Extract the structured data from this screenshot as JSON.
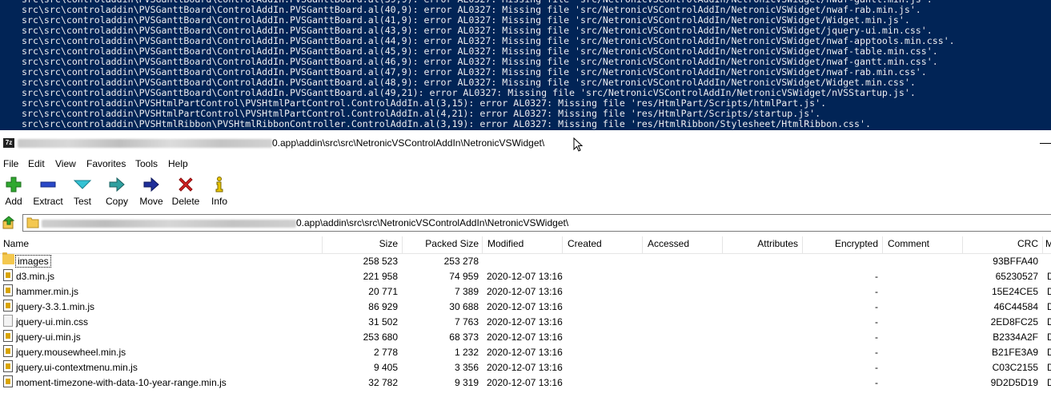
{
  "console": {
    "lines": [
      "src\\src\\controladdin\\PVSGanttBoard\\ControlAddIn.PVSGanttBoard.al(39,9): error AL0327: Missing file 'src/NetronicVSControlAddIn/NetronicVSWidget/nwaf-gantt.min.js'.",
      "src\\src\\controladdin\\PVSGanttBoard\\ControlAddIn.PVSGanttBoard.al(40,9): error AL0327: Missing file 'src/NetronicVSControlAddIn/NetronicVSWidget/nwaf-rab.min.js'.",
      "src\\src\\controladdin\\PVSGanttBoard\\ControlAddIn.PVSGanttBoard.al(41,9): error AL0327: Missing file 'src/NetronicVSControlAddIn/NetronicVSWidget/Widget.min.js'.",
      "src\\src\\controladdin\\PVSGanttBoard\\ControlAddIn.PVSGanttBoard.al(43,9): error AL0327: Missing file 'src/NetronicVSControlAddIn/NetronicVSWidget/jquery-ui.min.css'.",
      "src\\src\\controladdin\\PVSGanttBoard\\ControlAddIn.PVSGanttBoard.al(44,9): error AL0327: Missing file 'src/NetronicVSControlAddIn/NetronicVSWidget/nwaf-apptools.min.css'.",
      "src\\src\\controladdin\\PVSGanttBoard\\ControlAddIn.PVSGanttBoard.al(45,9): error AL0327: Missing file 'src/NetronicVSControlAddIn/NetronicVSWidget/nwaf-table.min.css'.",
      "src\\src\\controladdin\\PVSGanttBoard\\ControlAddIn.PVSGanttBoard.al(46,9): error AL0327: Missing file 'src/NetronicVSControlAddIn/NetronicVSWidget/nwaf-gantt.min.css'.",
      "src\\src\\controladdin\\PVSGanttBoard\\ControlAddIn.PVSGanttBoard.al(47,9): error AL0327: Missing file 'src/NetronicVSControlAddIn/NetronicVSWidget/nwaf-rab.min.css'.",
      "src\\src\\controladdin\\PVSGanttBoard\\ControlAddIn.PVSGanttBoard.al(48,9): error AL0327: Missing file 'src/NetronicVSControlAddIn/NetronicVSWidget/Widget.min.css'.",
      "src\\src\\controladdin\\PVSGanttBoard\\ControlAddIn.PVSGanttBoard.al(49,21): error AL0327: Missing file 'src/NetronicVSControlAddIn/NetronicVSWidget/nVSStartup.js'.",
      "src\\src\\controladdin\\PVSHtmlPartControl\\PVSHtmlPartControl.ControlAddIn.al(3,15): error AL0327: Missing file 'res/HtmlPart/Scripts/htmlPart.js'.",
      "src\\src\\controladdin\\PVSHtmlPartControl\\PVSHtmlPartControl.ControlAddIn.al(4,21): error AL0327: Missing file 'res/HtmlPart/Scripts/startup.js'.",
      "src\\src\\controladdin\\PVSHtmlRibbon\\PVSHtmlRibbonController.ControlAddIn.al(3,19): error AL0327: Missing file 'res/HtmlRibbon/Stylesheet/HtmlRibbon.css'."
    ]
  },
  "window": {
    "app_icon": "7z",
    "title_suffix": "0.app\\addin\\src\\src\\NetronicVSControlAddIn\\NetronicVSWidget\\"
  },
  "menu": [
    "File",
    "Edit",
    "View",
    "Favorites",
    "Tools",
    "Help"
  ],
  "toolbar": {
    "add": "Add",
    "extract": "Extract",
    "test": "Test",
    "copy": "Copy",
    "move": "Move",
    "delete": "Delete",
    "info": "Info"
  },
  "address": {
    "path_suffix": "0.app\\addin\\src\\src\\NetronicVSControlAddIn\\NetronicVSWidget\\"
  },
  "columns": {
    "name": "Name",
    "size": "Size",
    "packed_size": "Packed Size",
    "modified": "Modified",
    "created": "Created",
    "accessed": "Accessed",
    "attributes": "Attributes",
    "encrypted": "Encrypted",
    "comment": "Comment",
    "crc": "CRC",
    "more": "M"
  },
  "files": [
    {
      "name": "images",
      "type": "folder",
      "size": "258 523",
      "packed": "253 278",
      "modified": "",
      "encrypted": "",
      "crc": "93BFFA40",
      "more": ""
    },
    {
      "name": "d3.min.js",
      "type": "js",
      "size": "221 958",
      "packed": "74 959",
      "modified": "2020-12-07 13:16",
      "encrypted": "-",
      "crc": "65230527",
      "more": "D"
    },
    {
      "name": "hammer.min.js",
      "type": "js",
      "size": "20 771",
      "packed": "7 389",
      "modified": "2020-12-07 13:16",
      "encrypted": "-",
      "crc": "15E24CE5",
      "more": "D"
    },
    {
      "name": "jquery-3.3.1.min.js",
      "type": "js",
      "size": "86 929",
      "packed": "30 688",
      "modified": "2020-12-07 13:16",
      "encrypted": "-",
      "crc": "46C44584",
      "more": "D"
    },
    {
      "name": "jquery-ui.min.css",
      "type": "css",
      "size": "31 502",
      "packed": "7 763",
      "modified": "2020-12-07 13:16",
      "encrypted": "-",
      "crc": "2ED8FC25",
      "more": "D"
    },
    {
      "name": "jquery-ui.min.js",
      "type": "js",
      "size": "253 680",
      "packed": "68 373",
      "modified": "2020-12-07 13:16",
      "encrypted": "-",
      "crc": "B2334A2F",
      "more": "D"
    },
    {
      "name": "jquery.mousewheel.min.js",
      "type": "js",
      "size": "2 778",
      "packed": "1 232",
      "modified": "2020-12-07 13:16",
      "encrypted": "-",
      "crc": "B21FE3A9",
      "more": "D"
    },
    {
      "name": "jquery.ui-contextmenu.min.js",
      "type": "js",
      "size": "9 405",
      "packed": "3 356",
      "modified": "2020-12-07 13:16",
      "encrypted": "-",
      "crc": "C03C2155",
      "more": "D"
    },
    {
      "name": "moment-timezone-with-data-10-year-range.min.js",
      "type": "js",
      "size": "32 782",
      "packed": "9 319",
      "modified": "2020-12-07 13:16",
      "encrypted": "-",
      "crc": "9D2D5D19",
      "more": "D"
    }
  ]
}
